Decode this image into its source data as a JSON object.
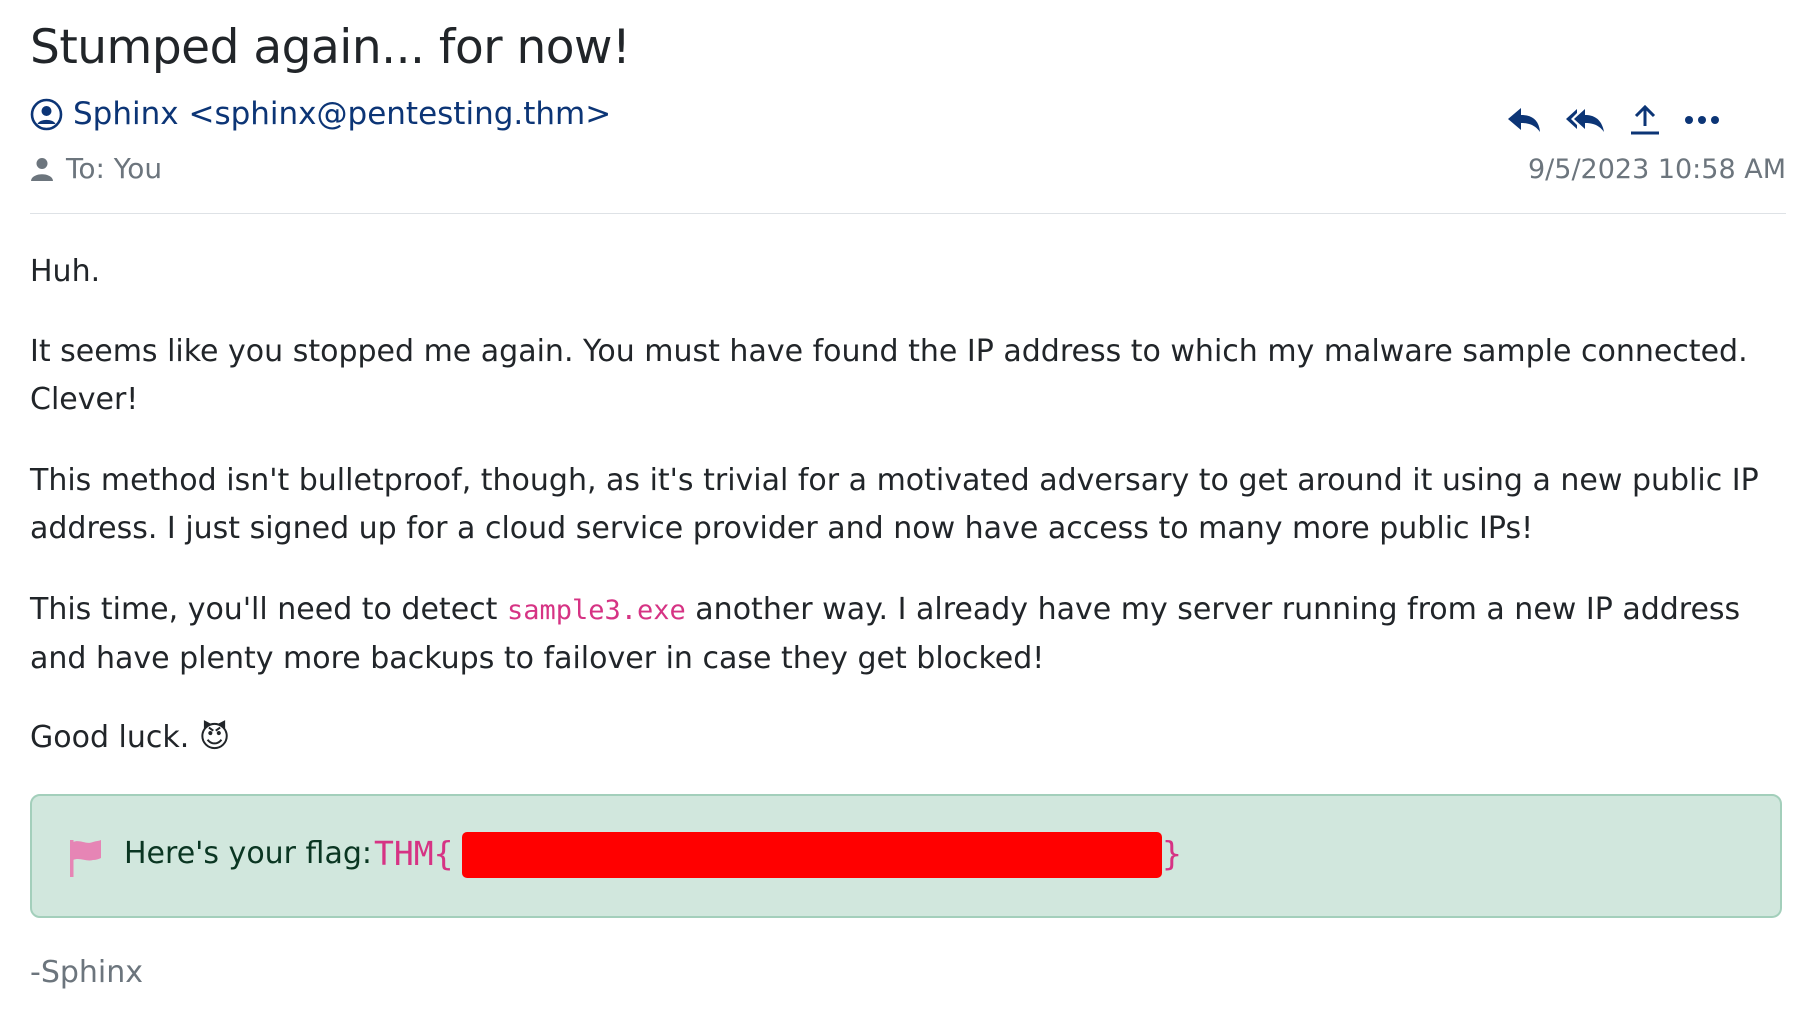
{
  "email": {
    "subject": "Stumped again... for now!",
    "sender": "Sphinx <sphinx@pentesting.thm>",
    "recipient": "To: You",
    "date": "9/5/2023 10:58 AM",
    "actions": {
      "reply_icon": "reply-icon",
      "reply_all_icon": "reply-all-icon",
      "forward_icon": "share-upload-icon",
      "more_icon": "more-ellipsis-icon"
    },
    "body": {
      "p1": "Huh.",
      "p2": "It seems like you stopped me again. You must have found the IP address to which my malware sample connected. Clever!",
      "p3": "This method isn't bulletproof, though, as it's trivial for a motivated adversary to get around it using a new public IP address. I just signed up for a cloud service provider and now have access to many more public IPs!",
      "p4_before": "This time, you'll need to detect ",
      "p4_code": "sample3.exe",
      "p4_after": " another way. I already have my server running from a new IP address and have plenty more backups to failover in case they get blocked!",
      "p5_text": "Good luck.",
      "p5_emoji": "😈"
    },
    "flag": {
      "label": "Here's your flag:",
      "prefix": "THM{",
      "suffix": "}",
      "icon": "flag-icon"
    },
    "signature": "-Sphinx"
  },
  "colors": {
    "link": "#0c3576",
    "muted": "#6c757d",
    "code": "#d63384",
    "alert_bg": "#d1e7dd",
    "redaction": "#ff0000"
  }
}
